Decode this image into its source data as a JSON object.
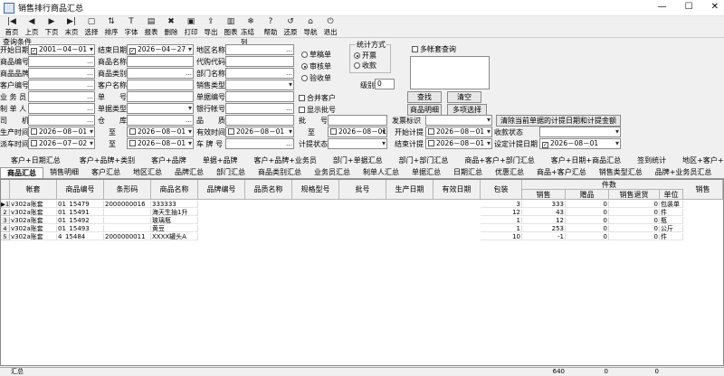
{
  "window": {
    "title": "销售排行商品汇总",
    "min": "—",
    "max": "☐",
    "close": "✕"
  },
  "toolbar": [
    {
      "label": "首页",
      "icon": "first-icon",
      "glyph": "|◀"
    },
    {
      "label": "上页",
      "icon": "prev-icon",
      "glyph": "◀"
    },
    {
      "label": "下页",
      "icon": "next-icon",
      "glyph": "▶"
    },
    {
      "label": "末页",
      "icon": "last-icon",
      "glyph": "▶|"
    },
    {
      "label": "选择",
      "icon": "select-icon",
      "glyph": "▢"
    },
    {
      "label": "排序",
      "icon": "sort-icon",
      "glyph": "⇅"
    },
    {
      "label": "字体",
      "icon": "font-icon",
      "glyph": "T"
    },
    {
      "label": "报表",
      "icon": "report-icon",
      "glyph": "▤"
    },
    {
      "label": "删除",
      "icon": "delete-icon",
      "glyph": "✖"
    },
    {
      "label": "打印",
      "icon": "print-icon",
      "glyph": "▣"
    },
    {
      "label": "导出",
      "icon": "export-icon",
      "glyph": "⇪"
    },
    {
      "label": "图表",
      "icon": "chart-icon",
      "glyph": "▥"
    },
    {
      "label": "冻结列",
      "icon": "freeze-icon",
      "glyph": "❄"
    },
    {
      "label": "帮助",
      "icon": "help-icon",
      "glyph": "?"
    },
    {
      "label": "还原",
      "icon": "restore-icon",
      "glyph": "↺"
    },
    {
      "label": "导航",
      "icon": "nav-icon",
      "glyph": "⌂"
    },
    {
      "label": "退出",
      "icon": "exit-icon",
      "glyph": "⏻"
    }
  ],
  "query": {
    "group_title": "查询条件",
    "labels": {
      "start_date": "开始日期",
      "end_date": "结束日期",
      "region": "地区名称",
      "goods_code": "商品编号",
      "goods_name": "商品名称",
      "agent_code": "代购代码",
      "goods_brand": "商品品牌",
      "goods_category": "商品类别",
      "dept_name": "部门名称",
      "customer_code": "客户编号",
      "customer_name": "客户名称",
      "sales_type": "销售类型",
      "salesman": "业 务 员",
      "doc_no": "单　　号",
      "doc_kind": "单据编号",
      "maker": "制 单 人",
      "doc_type": "单据类型",
      "bank_acct": "银行帐号",
      "driver": "司　　机",
      "warehouse": "仓　　库",
      "quality": "品　　质",
      "batch": "批　　号",
      "invoice_flag": "发票标识",
      "produce_time": "生产时间",
      "to": "至",
      "valid_time": "有效时间",
      "to2": "至",
      "start_calc": "开始计提",
      "delivery_time": "派车时间",
      "to3": "至",
      "plate": "车 牌 号",
      "calc_status": "计提状态",
      "end_calc": "结束计提",
      "settle_date": "设定计提日期",
      "receive_status": "收款状态",
      "level": "级别"
    },
    "values": {
      "start_date": "2001－04－01",
      "end_date": "2026－04－27",
      "produce_from": "2026－08－01",
      "produce_to": "2026－08－01",
      "valid_from": "2026－08－01",
      "valid_to": "2026－08－01",
      "start_calc": "2026－08－01",
      "end_calc": "2026－08－01",
      "settle_date": "2026－08－01",
      "delivery_from": "2026－07－02",
      "delivery_to": "2026－08－01",
      "calc_from": "2026－08－01",
      "level": "0"
    },
    "radios": {
      "draft": "草稿单",
      "audited": "审核单",
      "verify": "验收单"
    },
    "checks": {
      "merge_customer": "合并客户",
      "show_batch": "显示批号",
      "multi_account": "多帐套查询"
    },
    "stat_title": "统计方式",
    "stat_options": {
      "invoiced": "开票",
      "received": "收款"
    },
    "buttons": {
      "search": "查找",
      "clear": "清空",
      "goods_detail": "商品明细",
      "multi_select": "多项选择",
      "clear_calc": "清除当前单据的计提日期和计提金额"
    }
  },
  "tabs_row1": [
    "客户+日期汇总",
    "客户+品牌+类别",
    "客户+品牌",
    "单据+品牌",
    "客户+品牌+业务员",
    "部门+单据汇总",
    "部门+部门汇总",
    "商品+客户+部门汇总",
    "客户+日期+商品汇总",
    "签到统计",
    "地区+客户+商品汇总"
  ],
  "tabs_row2": [
    "商品汇总",
    "销售明细",
    "客户汇总",
    "地区汇总",
    "品牌汇总",
    "部门汇总",
    "商品类别汇总",
    "业务员汇总",
    "制单人汇总",
    "单据汇总",
    "日期汇总",
    "优惠汇总",
    "商品+客户汇总",
    "销售类型汇总",
    "品牌+业务员汇总"
  ],
  "table": {
    "headers": [
      "帐套",
      "商品编号",
      "条形码",
      "商品名称",
      "品牌编号",
      "品质名称",
      "规格型号",
      "批号",
      "生产日期",
      "有效日期",
      "包装"
    ],
    "group_header": "件数",
    "sub_headers": [
      "销售",
      "赠品",
      "销售退货",
      "单位",
      "销售"
    ],
    "rows": [
      {
        "acct": "v302a账套",
        "code": "01_15479",
        "barcode": "2000000016",
        "name": "333333",
        "pack": "3",
        "sale": "333",
        "gift": "0",
        "ret": "0",
        "unit": "包装单"
      },
      {
        "acct": "v302a账套",
        "code": "01_15491",
        "barcode": "",
        "name": "海天生抽1升",
        "pack": "12",
        "sale": "43",
        "gift": "0",
        "ret": "0",
        "unit": "件"
      },
      {
        "acct": "v302a账套",
        "code": "01_15492",
        "barcode": "",
        "name": "玻璃瓶",
        "pack": "1",
        "sale": "12",
        "gift": "0",
        "ret": "0",
        "unit": "瓶"
      },
      {
        "acct": "v302a账套",
        "code": "01_15493",
        "barcode": "",
        "name": "黄豆",
        "pack": "1",
        "sale": "253",
        "gift": "0",
        "ret": "0",
        "unit": "公斤"
      },
      {
        "acct": "v302a账套",
        "code": "4_15484",
        "barcode": "2000000011",
        "name": "XXXX罐头A",
        "pack": "10",
        "sale": "-1",
        "gift": "0",
        "ret": "0",
        "unit": "件"
      }
    ]
  },
  "footer": {
    "label": "汇总",
    "sale_total": "640",
    "gift_total": "0",
    "ret_total": "0"
  }
}
